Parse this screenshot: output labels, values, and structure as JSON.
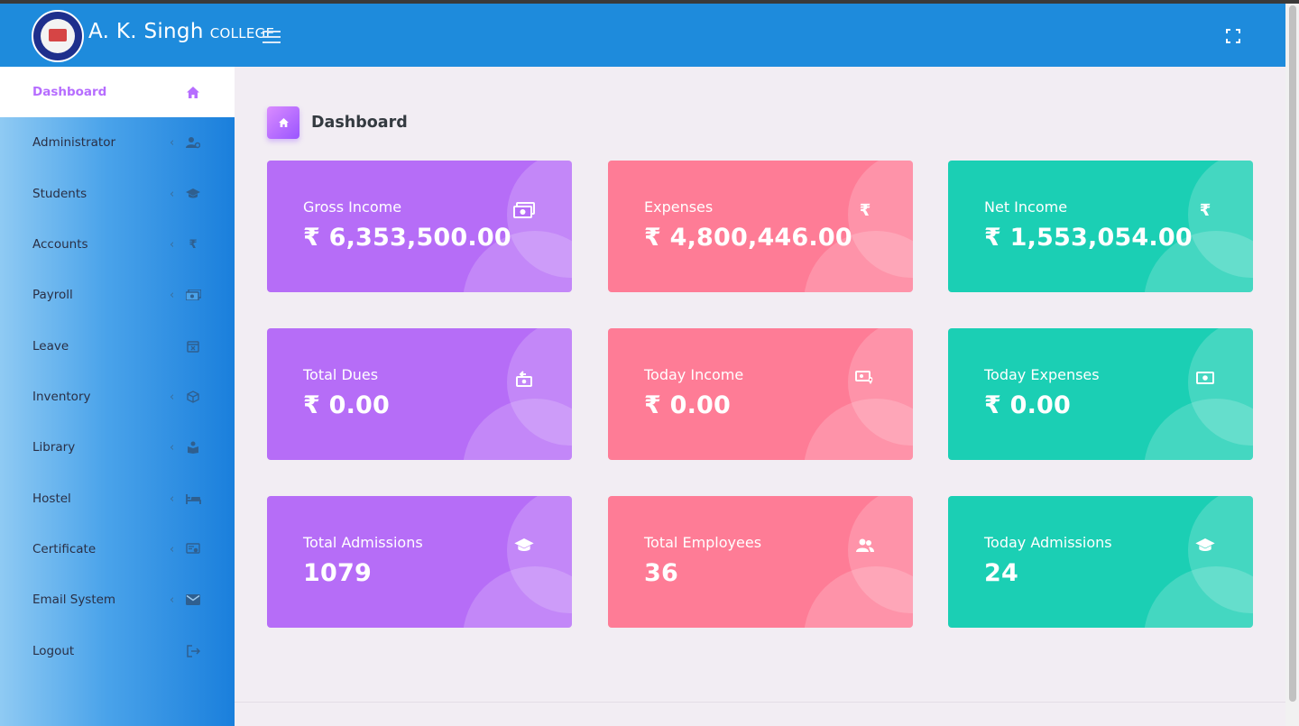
{
  "header": {
    "brand_main": "A. K. Singh",
    "brand_sub": "COLLEGE",
    "menu_toggle_icon": "hamburger-menu-icon",
    "fullscreen_icon": "fullscreen-icon",
    "background_color": "#1e8bdc"
  },
  "sidebar": {
    "items": [
      {
        "label": "Dashboard",
        "icon": "home-icon",
        "active": true,
        "has_submenu": false
      },
      {
        "label": "Administrator",
        "icon": "user-gear-icon",
        "active": false,
        "has_submenu": true
      },
      {
        "label": "Students",
        "icon": "graduation-cap-icon",
        "active": false,
        "has_submenu": true
      },
      {
        "label": "Accounts",
        "icon": "rupee-icon",
        "active": false,
        "has_submenu": true
      },
      {
        "label": "Payroll",
        "icon": "cash-icon",
        "active": false,
        "has_submenu": true
      },
      {
        "label": "Leave",
        "icon": "calendar-x-icon",
        "active": false,
        "has_submenu": false
      },
      {
        "label": "Inventory",
        "icon": "box-icon",
        "active": false,
        "has_submenu": true
      },
      {
        "label": "Library",
        "icon": "book-reader-icon",
        "active": false,
        "has_submenu": true
      },
      {
        "label": "Hostel",
        "icon": "bed-icon",
        "active": false,
        "has_submenu": true
      },
      {
        "label": "Certificate",
        "icon": "certificate-icon",
        "active": false,
        "has_submenu": true
      },
      {
        "label": "Email System",
        "icon": "envelope-icon",
        "active": false,
        "has_submenu": true
      },
      {
        "label": "Logout",
        "icon": "logout-icon",
        "active": false,
        "has_submenu": false
      }
    ],
    "chevron": "‹"
  },
  "page": {
    "title": "Dashboard",
    "icon": "home-icon"
  },
  "cards": [
    {
      "label": "Gross Income",
      "value": "₹ 6,353,500.00",
      "icon": "cash-multiple-icon",
      "color": "#b66df7"
    },
    {
      "label": "Expenses",
      "value": "₹ 4,800,446.00",
      "icon": "rupee-icon",
      "color": "#fe7c96"
    },
    {
      "label": "Net Income",
      "value": "₹ 1,553,054.00",
      "icon": "rupee-icon",
      "color": "#1bcfb4"
    },
    {
      "label": "Total Dues",
      "value": "₹ 0.00",
      "icon": "cash-refund-icon",
      "color": "#b66df7"
    },
    {
      "label": "Today Income",
      "value": "₹ 0.00",
      "icon": "cash-marker-icon",
      "color": "#fe7c96"
    },
    {
      "label": "Today Expenses",
      "value": "₹ 0.00",
      "icon": "cash-icon",
      "color": "#1bcfb4"
    },
    {
      "label": "Total Admissions",
      "value": "1079",
      "icon": "graduation-cap-icon",
      "color": "#b66df7"
    },
    {
      "label": "Total Employees",
      "value": "36",
      "icon": "users-icon",
      "color": "#fe7c96"
    },
    {
      "label": "Today Admissions",
      "value": "24",
      "icon": "graduation-cap-icon",
      "color": "#1bcfb4"
    }
  ],
  "colors": {
    "accent": "#b66dff",
    "content_background": "#f2edf3"
  }
}
